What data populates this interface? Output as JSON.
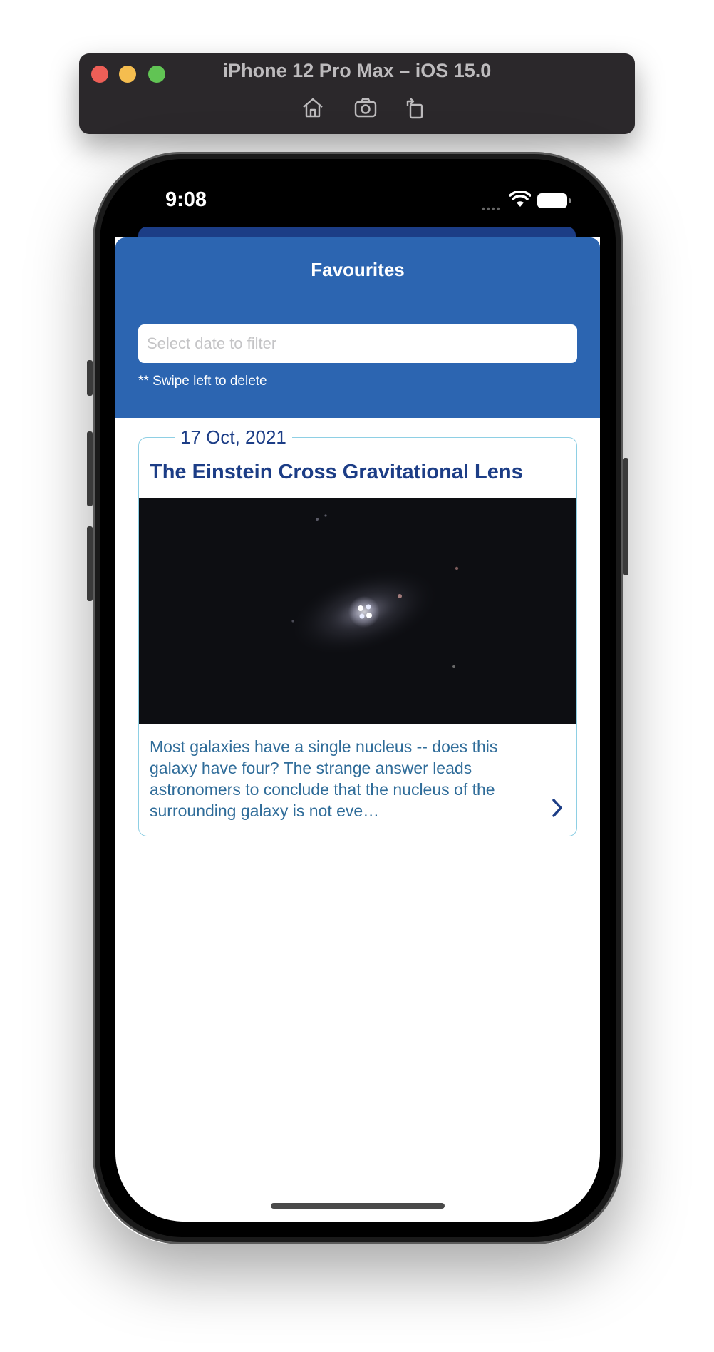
{
  "simulator": {
    "title": "iPhone 12 Pro Max – iOS 15.0",
    "toolbar_icons": [
      "home-icon",
      "screenshot-icon",
      "rotate-icon"
    ],
    "colors": {
      "bar": "#2b282b",
      "close": "#ee5f57",
      "minimize": "#f5bd4f",
      "zoom": "#61c454"
    }
  },
  "status_bar": {
    "time": "9:08"
  },
  "header": {
    "title": "Favourites",
    "filter_placeholder": "Select date to filter",
    "hint": "** Swipe left to delete",
    "color": "#2c65b1"
  },
  "favourites": [
    {
      "date": "17 Oct, 2021",
      "title": "The Einstein Cross Gravitational Lens",
      "description": "Most galaxies have a single nucleus -- does this galaxy have four?  The strange answer leads astronomers to conclude that the nucleus of the surrounding galaxy is not eve…"
    }
  ],
  "colors": {
    "title_text": "#1c3d86",
    "description_text": "#2f6c99",
    "card_border": "#8ecfe4"
  }
}
